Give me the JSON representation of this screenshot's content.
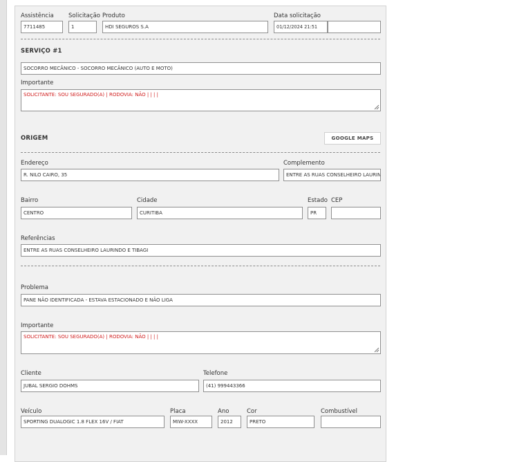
{
  "header": {
    "assistencia": {
      "label": "Assistência",
      "value": "7711485"
    },
    "solicitacao": {
      "label": "Solicitação",
      "value": "1"
    },
    "produto": {
      "label": "Produto",
      "value": "HDI SEGUROS S.A"
    },
    "data": {
      "label": "Data solicitação",
      "value": "01/12/2024 21:51",
      "extra": ""
    }
  },
  "servico": {
    "title": "SERVIÇO #1",
    "value": "SOCORRO MECÂNICO - SOCORRO MECÂNICO (AUTO E MOTO)",
    "importante_label": "Importante",
    "importante_value": "SOLICITANTE: SOU SEGURADO(A) | RODOVIA: NÃO |  |  |  |"
  },
  "origem": {
    "title": "ORIGEM",
    "maps_button": "GOOGLE MAPS",
    "endereco": {
      "label": "Endereço",
      "value": "R. NILO CAIRO, 35"
    },
    "complemento": {
      "label": "Complemento",
      "value": "ENTRE AS RUAS CONSELHEIRO LAURINDO E TIBAGI"
    },
    "bairro": {
      "label": "Bairro",
      "value": "CENTRO"
    },
    "cidade": {
      "label": "Cidade",
      "value": "CURITIBA"
    },
    "estado": {
      "label": "Estado",
      "value": "PR"
    },
    "cep": {
      "label": "CEP",
      "value": ""
    },
    "referencias": {
      "label": "Referências",
      "value": "ENTRE AS RUAS CONSELHEIRO LAURINDO E TIBAGI"
    }
  },
  "problema": {
    "label": "Problema",
    "value": "PANE NÃO IDENTIFICADA - ESTAVA ESTACIONADO E NÃO LIGA"
  },
  "importante2": {
    "label": "Importante",
    "value": "SOLICITANTE: SOU SEGURADO(A) | RODOVIA: NÃO |  |  |  |"
  },
  "cliente": {
    "label": "Cliente",
    "value": "JUBAL SERGIO DOHMS"
  },
  "telefone": {
    "label": "Telefone",
    "value": "(41) 999443366"
  },
  "veiculo": {
    "label": "Veículo",
    "value": "SPORTING DUALOGIC 1.8 FLEX 16V / FIAT"
  },
  "placa": {
    "label": "Placa",
    "value": "MIW-XXXX"
  },
  "ano": {
    "label": "Ano",
    "value": "2012"
  },
  "cor": {
    "label": "Cor",
    "value": "PRETO"
  },
  "combustivel": {
    "label": "Combustível",
    "value": ""
  },
  "colors": {
    "importante_text": "#d01c1c",
    "panel_bg": "#f1f1f1"
  }
}
